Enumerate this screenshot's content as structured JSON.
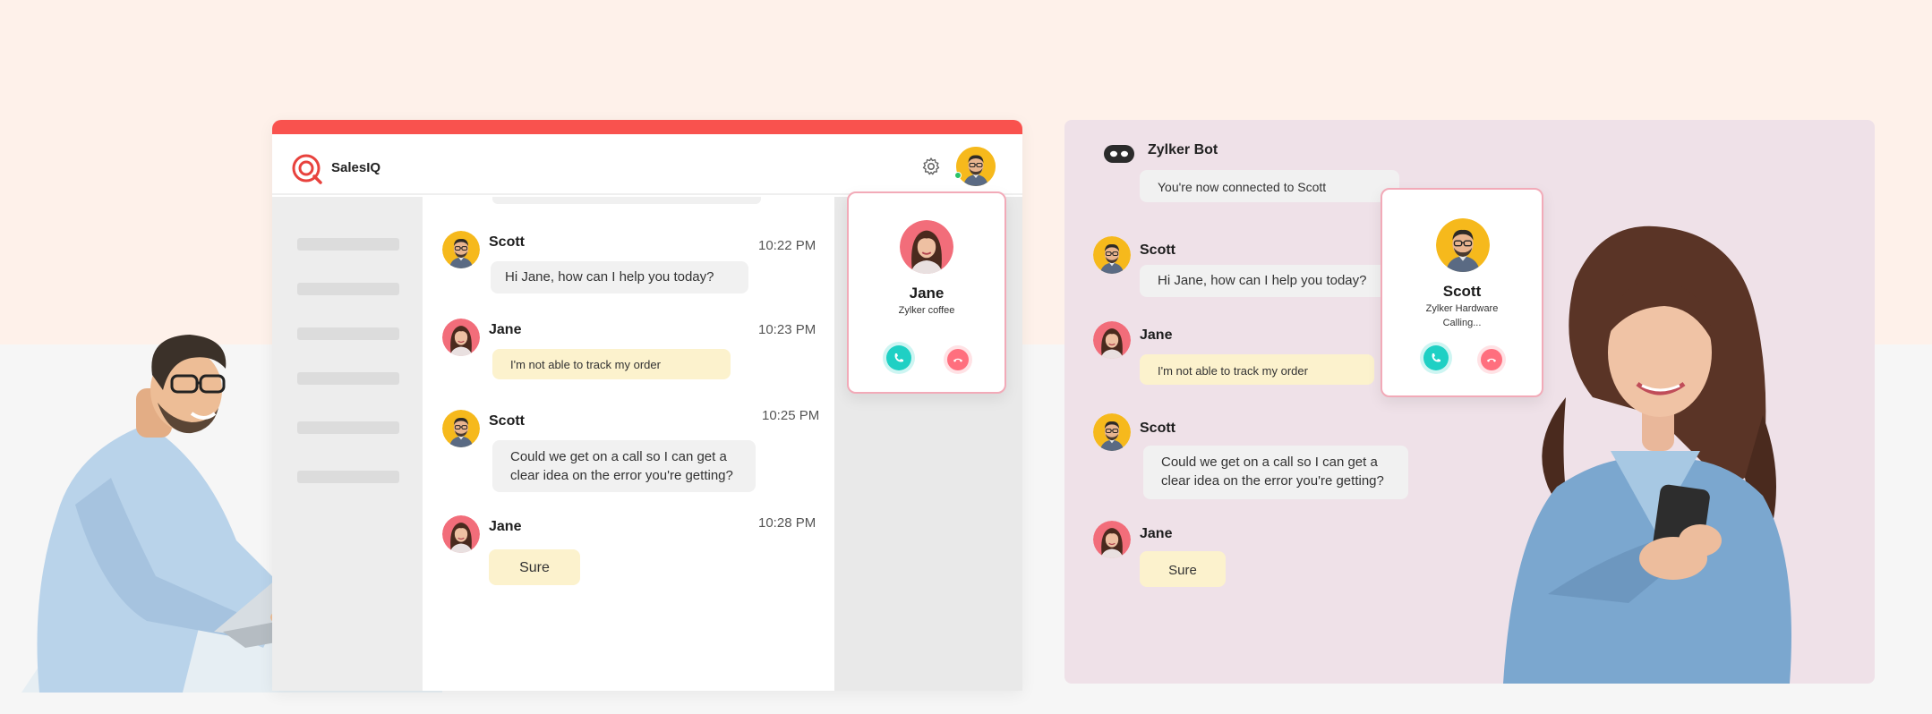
{
  "left_app": {
    "brand": "SalesIQ",
    "header_icons": [
      "salesiq-logo-icon",
      "gear-icon",
      "avatar"
    ],
    "messages": [
      {
        "name": "Scott",
        "time": "10:22 PM",
        "text": "Hi  Jane,   how can I help you today?"
      },
      {
        "name": "Jane",
        "time": "10:23 PM",
        "text": "I'm not able to track my order"
      },
      {
        "name": "Scott",
        "time": "10:25 PM",
        "text_line1": "Could we get on a call so I can get a",
        "text_line2": "clear idea on the error you're getting?"
      },
      {
        "name": "Jane",
        "time": "10:28 PM",
        "text": "Sure"
      }
    ],
    "call_card": {
      "name": "Jane",
      "company": "Zylker coffee"
    }
  },
  "right_panel": {
    "bot_name": "Zylker Bot",
    "bot_message": "You're now connected to Scott",
    "messages": [
      {
        "name": "Scott",
        "text": "Hi  Jane,   how can I help you today?"
      },
      {
        "name": "Jane",
        "text": "I'm not able to track my order"
      },
      {
        "name": "Scott",
        "text_line1": "Could we get on a call so I can get a",
        "text_line2": "clear idea on the error you're getting?"
      },
      {
        "name": "Jane",
        "text": "Sure"
      }
    ],
    "call_card": {
      "name": "Scott",
      "company": "Zylker Hardware",
      "status": "Calling..."
    }
  },
  "colors": {
    "brand_red": "#f9524e",
    "accept": "#1fd0c4",
    "decline": "#ff6f7e",
    "bubble_yellow": "#fcf2cd",
    "bubble_grey": "#f1f1f1",
    "panel_pink": "#efe1e8",
    "bg_peach": "#fef1ea"
  }
}
